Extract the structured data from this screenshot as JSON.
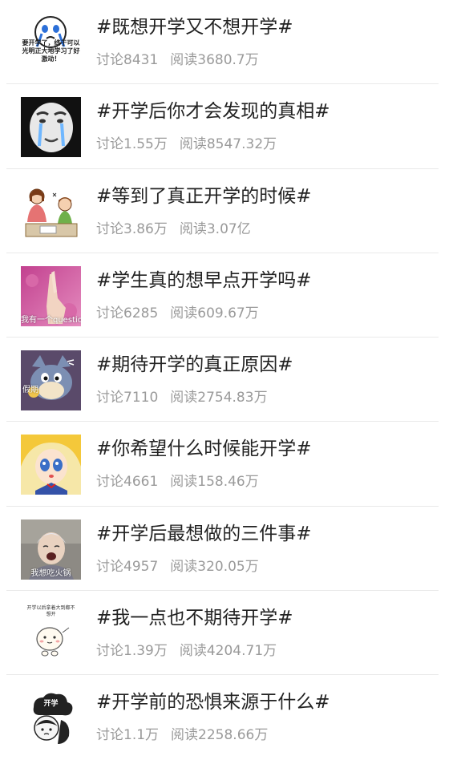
{
  "topics": [
    {
      "title": "#既想开学又不想开学#",
      "discussion": "讨论8431",
      "reads": "阅读3680.7万",
      "image_caption": "要开学了，终于可以光明正大地学习了好激动！",
      "icon": "crying-emoji-image"
    },
    {
      "title": "#开学后你才会发现的真相#",
      "discussion": "讨论1.55万",
      "reads": "阅读8547.32万",
      "image_caption": "",
      "icon": "crying-face-meme-image"
    },
    {
      "title": "#等到了真正开学的时候#",
      "discussion": "讨论3.86万",
      "reads": "阅读3.07亿",
      "image_caption": "",
      "icon": "mother-child-homework-image"
    },
    {
      "title": "#学生真的想早点开学吗#",
      "discussion": "讨论6285",
      "reads": "阅读609.67万",
      "image_caption": "我有一个question",
      "icon": "raised-hand-image"
    },
    {
      "title": "#期待开学的真正原因#",
      "discussion": "讨论7110",
      "reads": "阅读2754.83万",
      "image_caption": "假期",
      "icon": "tom-cat-image"
    },
    {
      "title": "#你希望什么时候能开学#",
      "discussion": "讨论4661",
      "reads": "阅读158.46万",
      "image_caption": "",
      "icon": "anime-girl-image"
    },
    {
      "title": "#开学后最想做的三件事#",
      "discussion": "讨论4957",
      "reads": "阅读320.05万",
      "image_caption": "我想吃火锅",
      "icon": "crying-person-image"
    },
    {
      "title": "#我一点也不期待开学#",
      "discussion": "讨论1.39万",
      "reads": "阅读4204.71万",
      "image_caption": "开学以后拿着大到都不想开",
      "icon": "cute-doodle-image"
    },
    {
      "title": "#开学前的恐惧来源于什么#",
      "discussion": "讨论1.1万",
      "reads": "阅读2258.66万",
      "image_caption": "开学",
      "icon": "fear-cloud-image"
    }
  ]
}
